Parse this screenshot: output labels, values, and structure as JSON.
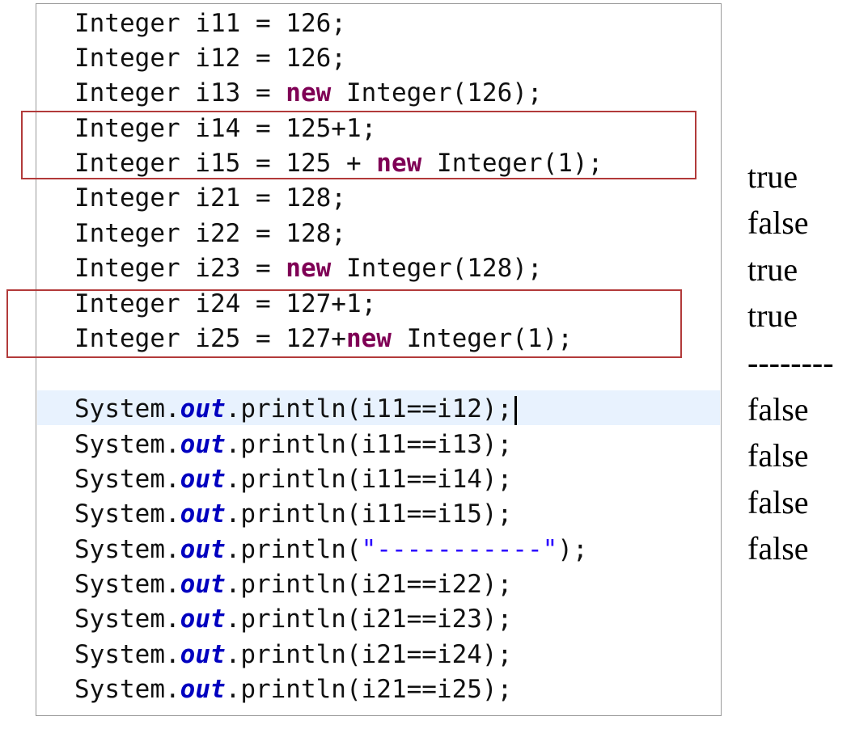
{
  "code": {
    "lines": [
      {
        "pre": "Integer i11 = 126;",
        "kw": "",
        "post": ""
      },
      {
        "pre": "Integer i12 = 126;",
        "kw": "",
        "post": ""
      },
      {
        "pre": "Integer i13 = ",
        "kw": "new",
        "post": " Integer(126);"
      },
      {
        "pre": "Integer i14 = 125+1;",
        "kw": "",
        "post": ""
      },
      {
        "pre": "Integer i15 = 125 + ",
        "kw": "new",
        "post": " Integer(1);"
      },
      {
        "pre": "Integer i21 = 128;",
        "kw": "",
        "post": ""
      },
      {
        "pre": "Integer i22 = 128;",
        "kw": "",
        "post": ""
      },
      {
        "pre": "Integer i23 = ",
        "kw": "new",
        "post": " Integer(128);"
      },
      {
        "pre": "Integer i24 = 127+1;",
        "kw": "",
        "post": ""
      },
      {
        "pre": "Integer i25 = 127+",
        "kw": "new",
        "post": " Integer(1);"
      }
    ],
    "prints": [
      {
        "obj": "System.",
        "field": "out",
        "call": ".println(i11==i12);"
      },
      {
        "obj": "System.",
        "field": "out",
        "call": ".println(i11==i13);"
      },
      {
        "obj": "System.",
        "field": "out",
        "call": ".println(i11==i14);"
      },
      {
        "obj": "System.",
        "field": "out",
        "call": ".println(i11==i15);"
      },
      {
        "obj": "System.",
        "field": "out",
        "call": ".println(",
        "str": "\"-----------\"",
        "tail": ");"
      },
      {
        "obj": "System.",
        "field": "out",
        "call": ".println(i21==i22);"
      },
      {
        "obj": "System.",
        "field": "out",
        "call": ".println(i21==i23);"
      },
      {
        "obj": "System.",
        "field": "out",
        "call": ".println(i21==i24);"
      },
      {
        "obj": "System.",
        "field": "out",
        "call": ".println(i21==i25);"
      }
    ]
  },
  "output": [
    "true",
    "false",
    "true",
    "true",
    "--------",
    "false",
    "false",
    "false",
    "false"
  ],
  "colors": {
    "keyword": "#7f0055",
    "field": "#0000c0",
    "string": "#2a00ff",
    "highlight_border": "#b23a3a",
    "current_line": "#e8f2fe"
  }
}
